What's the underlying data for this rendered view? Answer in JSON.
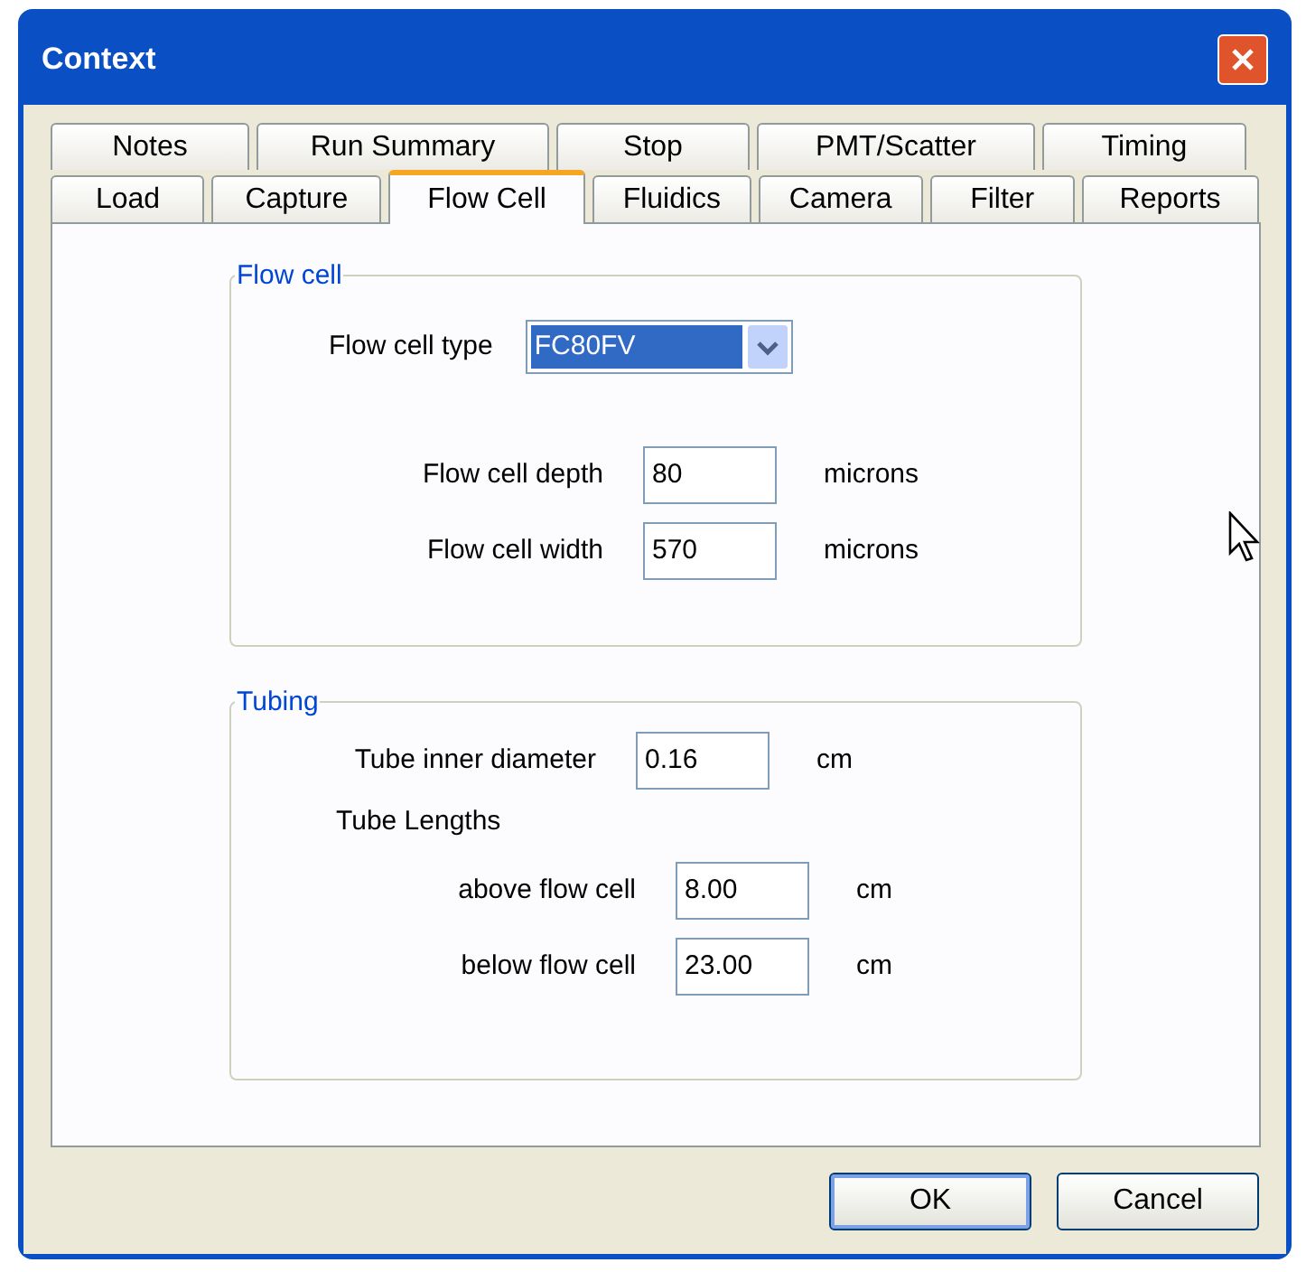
{
  "window": {
    "title": "Context"
  },
  "tab_rows": [
    [
      {
        "label": "Notes",
        "selected": false
      },
      {
        "label": "Run Summary",
        "selected": false
      },
      {
        "label": "Stop",
        "selected": false
      },
      {
        "label": "PMT/Scatter",
        "selected": false
      },
      {
        "label": "Timing",
        "selected": false
      }
    ],
    [
      {
        "label": "Load",
        "selected": false
      },
      {
        "label": "Capture",
        "selected": false
      },
      {
        "label": "Flow Cell",
        "selected": true
      },
      {
        "label": "Fluidics",
        "selected": false
      },
      {
        "label": "Camera",
        "selected": false
      },
      {
        "label": "Filter",
        "selected": false
      },
      {
        "label": "Reports",
        "selected": false
      }
    ]
  ],
  "groups": [
    {
      "title": "Flow cell",
      "items": [
        {
          "kind": "dropdown",
          "label": "Flow cell type",
          "value": "FC80FV",
          "highlighted": true
        },
        {
          "kind": "field",
          "label": "Flow cell depth",
          "value": "80",
          "unit": "microns"
        },
        {
          "kind": "field",
          "label": "Flow cell width",
          "value": "570",
          "unit": "microns"
        }
      ]
    },
    {
      "title": "Tubing",
      "items": [
        {
          "kind": "field",
          "label": "Tube inner diameter",
          "value": "0.16",
          "unit": "cm"
        },
        {
          "kind": "heading",
          "label": "Tube Lengths",
          "children": [
            {
              "kind": "field",
              "label": "above flow cell",
              "value": "8.00",
              "unit": "cm"
            },
            {
              "kind": "field",
              "label": "below flow cell",
              "value": "23.00",
              "unit": "cm"
            }
          ]
        }
      ]
    }
  ],
  "buttons": [
    "OK",
    "Cancel"
  ]
}
